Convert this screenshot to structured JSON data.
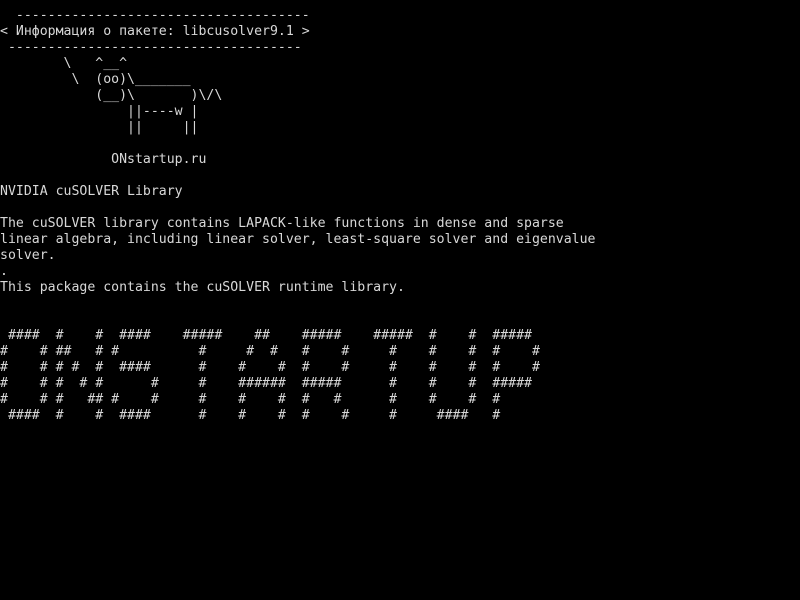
{
  "colors": {
    "background": "#000000",
    "foreground": "#d8d8d8"
  },
  "terminal": {
    "lines": [
      "  -------------------------------------",
      "< Информация о пакете: libcusolver9.1 >",
      " -------------------------------------",
      "        \\   ^__^",
      "         \\  (oo)\\_______",
      "            (__)\\       )\\/\\",
      "                ||----w |",
      "                ||     ||",
      "",
      "              ONstartup.ru",
      "",
      "NVIDIA cuSOLVER Library",
      "",
      "The cuSOLVER library contains LAPACK-like functions in dense and sparse",
      "linear algebra, including linear solver, least-square solver and eigenvalue",
      "solver.",
      ".",
      "This package contains the cuSOLVER runtime library.",
      "",
      "",
      " ####  #    #  ####    #####    ##    #####    #####  #    #  #####",
      "#    # ##   # #          #     #  #   #    #     #    #    #  #    #",
      "#    # # #  #  ####      #    #    #  #    #     #    #    #  #    #",
      "#    # #  # #      #     #    ######  #####      #    #    #  #####",
      "#    # #   ## #    #     #    #    #  #   #      #    #    #  #",
      " ####  #    #  ####      #    #    #  #    #     #     ####   #"
    ]
  }
}
